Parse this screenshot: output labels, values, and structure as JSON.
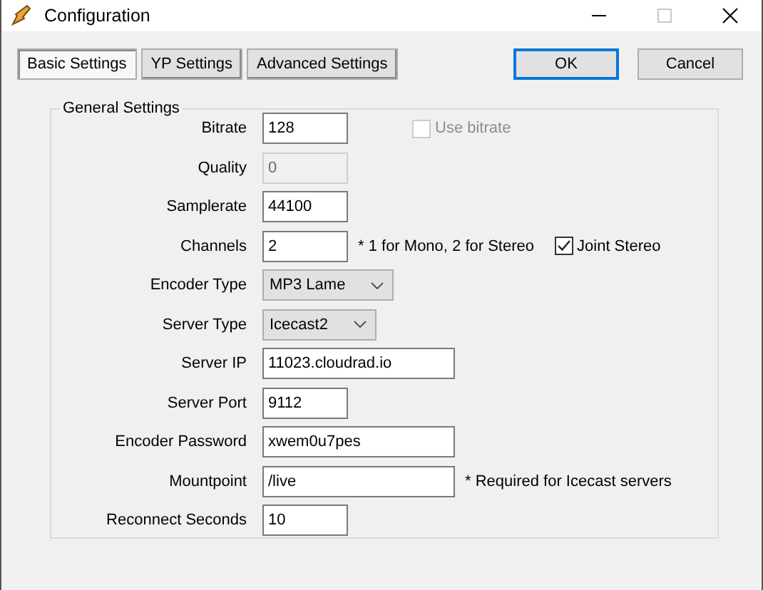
{
  "window": {
    "title": "Configuration"
  },
  "tabs": [
    {
      "label": "Basic Settings",
      "selected": true
    },
    {
      "label": "YP Settings",
      "selected": false
    },
    {
      "label": "Advanced Settings",
      "selected": false
    }
  ],
  "buttons": [
    {
      "label": "OK",
      "focused": true
    },
    {
      "label": "Cancel",
      "focused": false
    }
  ],
  "group": {
    "title": "General Settings",
    "rows": [
      {
        "label": "Bitrate",
        "kind": "text",
        "value": "128",
        "extras": [
          {
            "kind": "checkbox",
            "label": "Use bitrate",
            "checked": false,
            "disabled": true
          }
        ]
      },
      {
        "label": "Quality",
        "kind": "text",
        "value": "0",
        "disabled": true
      },
      {
        "label": "Samplerate",
        "kind": "text",
        "value": "44100"
      },
      {
        "label": "Channels",
        "kind": "text",
        "value": "2",
        "extras": [
          {
            "kind": "note",
            "label": "* 1 for Mono, 2 for Stereo"
          },
          {
            "kind": "checkbox",
            "label": "Joint Stereo",
            "checked": true,
            "disabled": false
          }
        ]
      },
      {
        "label": "Encoder Type",
        "kind": "select",
        "value": "MP3 Lame"
      },
      {
        "label": "Server Type",
        "kind": "select",
        "value": "Icecast2"
      },
      {
        "label": "Server IP",
        "kind": "wide-text",
        "value": "11023.cloudrad.io"
      },
      {
        "label": "Server Port",
        "kind": "text",
        "value": "9112"
      },
      {
        "label": "Encoder Password",
        "kind": "wide-text",
        "value": "xwem0u7pes"
      },
      {
        "label": "Mountpoint",
        "kind": "wide-text",
        "value": "/live",
        "extras": [
          {
            "kind": "note",
            "label": "* Required for Icecast servers"
          }
        ]
      },
      {
        "label": "Reconnect Seconds",
        "kind": "text",
        "value": "10"
      }
    ]
  }
}
